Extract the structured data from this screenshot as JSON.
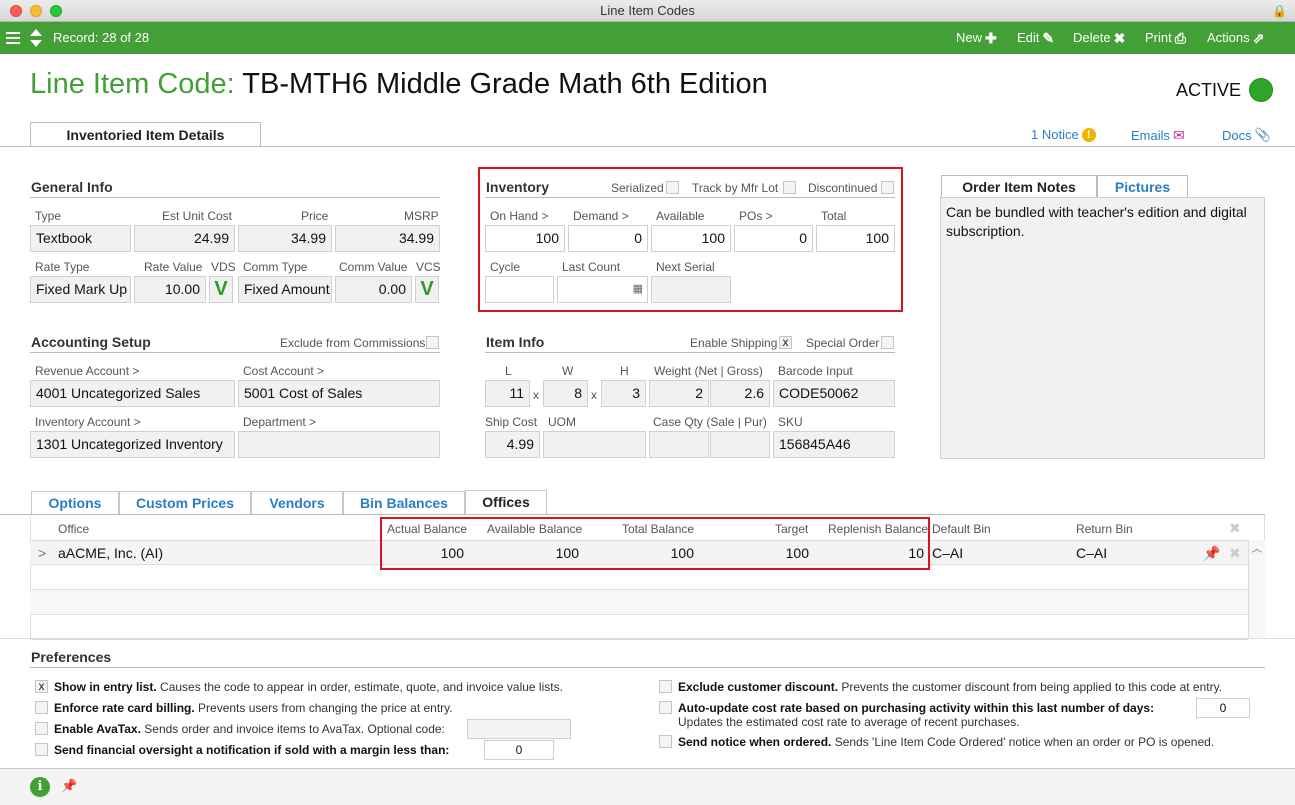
{
  "window": {
    "title": "Line Item Codes"
  },
  "toolbar": {
    "record": "Record: 28 of 28",
    "new": "New",
    "edit": "Edit",
    "delete": "Delete",
    "print": "Print",
    "actions": "Actions"
  },
  "header": {
    "label": "Line Item Code:",
    "value": "TB-MTH6 Middle Grade Math 6th Edition",
    "status": "ACTIVE",
    "status_color": "#2ea52a"
  },
  "tabs": {
    "main": "Inventoried Item Details"
  },
  "links": {
    "notice": "1 Notice",
    "emails": "Emails",
    "docs": "Docs"
  },
  "general": {
    "title": "General Info",
    "type_label": "Type",
    "est_cost_label": "Est Unit Cost",
    "price_label": "Price",
    "msrp_label": "MSRP",
    "type": "Textbook",
    "est_cost": "24.99",
    "price": "34.99",
    "msrp": "34.99",
    "rate_type_label": "Rate Type",
    "rate_value_label": "Rate Value",
    "vds_label": "VDS",
    "comm_type_label": "Comm Type",
    "comm_value_label": "Comm Value",
    "vcs_label": "VCS",
    "rate_type": "Fixed Mark Up",
    "rate_value": "10.00",
    "vds": "V",
    "comm_type": "Fixed Amount",
    "comm_value": "0.00",
    "vcs": "V"
  },
  "inventory": {
    "title": "Inventory",
    "serialized": "Serialized",
    "track_lot": "Track by Mfr Lot",
    "discontinued": "Discontinued",
    "on_hand_label": "On Hand >",
    "demand_label": "Demand >",
    "available_label": "Available",
    "pos_label": "POs >",
    "total_label": "Total",
    "on_hand": "100",
    "demand": "0",
    "available": "100",
    "pos": "0",
    "total": "100",
    "cycle_label": "Cycle",
    "last_count_label": "Last Count",
    "next_serial_label": "Next Serial"
  },
  "notes": {
    "tab_notes": "Order Item Notes",
    "tab_pictures": "Pictures",
    "text": "Can be bundled with teacher's edition and digital subscription."
  },
  "accounting": {
    "title": "Accounting Setup",
    "exclude": "Exclude from Commissions",
    "revenue_label": "Revenue Account >",
    "cost_label": "Cost Account >",
    "revenue": "4001 Uncategorized Sales",
    "cost": "5001 Cost of Sales",
    "inventory_label": "Inventory Account >",
    "department_label": "Department >",
    "inventory": "1301 Uncategorized Inventory"
  },
  "item_info": {
    "title": "Item Info",
    "enable_shipping": "Enable Shipping",
    "enable_shipping_mark": "x",
    "special_order": "Special Order",
    "l_label": "L",
    "w_label": "W",
    "h_label": "H",
    "weight_label": "Weight (Net | Gross)",
    "barcode_label": "Barcode Input",
    "l": "11",
    "w": "8",
    "h": "3",
    "x_sep": "x",
    "weight_net": "2",
    "weight_gross": "2.6",
    "barcode": "CODE50062",
    "ship_cost_label": "Ship Cost",
    "uom_label": "UOM",
    "case_qty_label": "Case Qty (Sale | Pur)",
    "sku_label": "SKU",
    "ship_cost": "4.99",
    "sku": "156845A46"
  },
  "bottom_tabs": [
    "Options",
    "Custom Prices",
    "Vendors",
    "Bin Balances",
    "Offices"
  ],
  "offices": {
    "headers": {
      "office": "Office",
      "actual": "Actual Balance",
      "available": "Available Balance",
      "total": "Total Balance",
      "target": "Target",
      "replenish": "Replenish Balance",
      "default_bin": "Default Bin",
      "return_bin": "Return Bin"
    },
    "rows": [
      {
        "expander": ">",
        "office": "aACME, Inc.  (AI)",
        "actual": "100",
        "available": "100",
        "total": "100",
        "target": "100",
        "replenish": "10",
        "default_bin": "C–AI",
        "return_bin": "C–AI"
      }
    ]
  },
  "preferences": {
    "title": "Preferences",
    "items": [
      {
        "bold": "Show in entry list.",
        "text": " Causes the code to appear in order, estimate, quote, and invoice value lists.",
        "checked": "x"
      },
      {
        "bold": "Enforce rate card billing.",
        "text": " Prevents users from changing the price at entry.",
        "checked": ""
      },
      {
        "bold": "Enable AvaTax.",
        "text": " Sends order and invoice items to AvaTax. Optional code:",
        "checked": ""
      },
      {
        "bold": "Send financial oversight a notification if sold with a margin less than:",
        "text": "",
        "checked": "",
        "value": "0"
      },
      {
        "bold": "Exclude customer discount.",
        "text": " Prevents the customer discount from being applied to this code at entry.",
        "checked": ""
      },
      {
        "bold": "Auto-update cost rate based on purchasing activity within this last number of days:",
        "text": "",
        "sub": "Updates the estimated cost rate to average of recent purchases.",
        "checked": "",
        "value": "0"
      },
      {
        "bold": "Send notice when ordered.",
        "text": " Sends 'Line Item Code Ordered' notice when an order or PO is opened.",
        "checked": ""
      }
    ]
  }
}
